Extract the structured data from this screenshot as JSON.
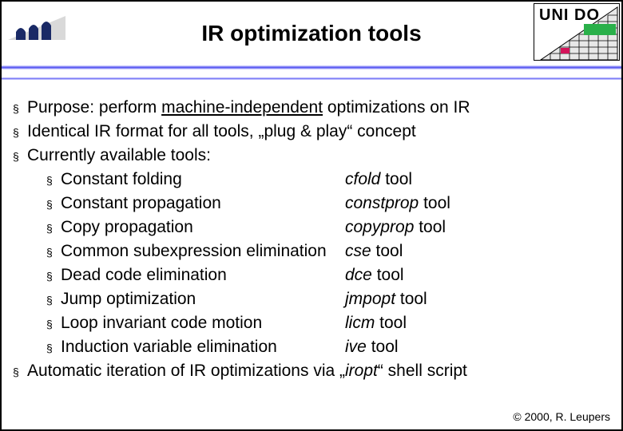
{
  "header": {
    "title": "IR optimization tools",
    "right_logo_label": "UNI DO"
  },
  "bullets": {
    "b1_pre": "Purpose: perform ",
    "b1_u": "machine-independent",
    "b1_post": " optimizations on IR",
    "b2": "Identical IR format for all tools, „plug & play“ concept",
    "b3": "Currently available tools:",
    "tools": [
      {
        "name": "Constant folding",
        "cmd": "cfold",
        "suffix": " tool"
      },
      {
        "name": "Constant propagation",
        "cmd": "constprop",
        "suffix": " tool"
      },
      {
        "name": "Copy propagation",
        "cmd": "copyprop",
        "suffix": " tool"
      },
      {
        "name": "Common subexpression elimination",
        "cmd": "cse",
        "suffix": " tool"
      },
      {
        "name": "Dead code elimination",
        "cmd": "dce",
        "suffix": " tool"
      },
      {
        "name": "Jump optimization",
        "cmd": "jmpopt",
        "suffix": " tool"
      },
      {
        "name": "Loop invariant code motion",
        "cmd": "licm",
        "suffix": " tool"
      },
      {
        "name": "Induction variable elimination",
        "cmd": "ive",
        "suffix": " tool"
      }
    ],
    "b4_pre": "Automatic iteration of IR optimizations via „",
    "b4_i": "iropt",
    "b4_post": "“ shell script"
  },
  "footer": "© 2000, R. Leupers",
  "glyph": {
    "square": "§"
  }
}
